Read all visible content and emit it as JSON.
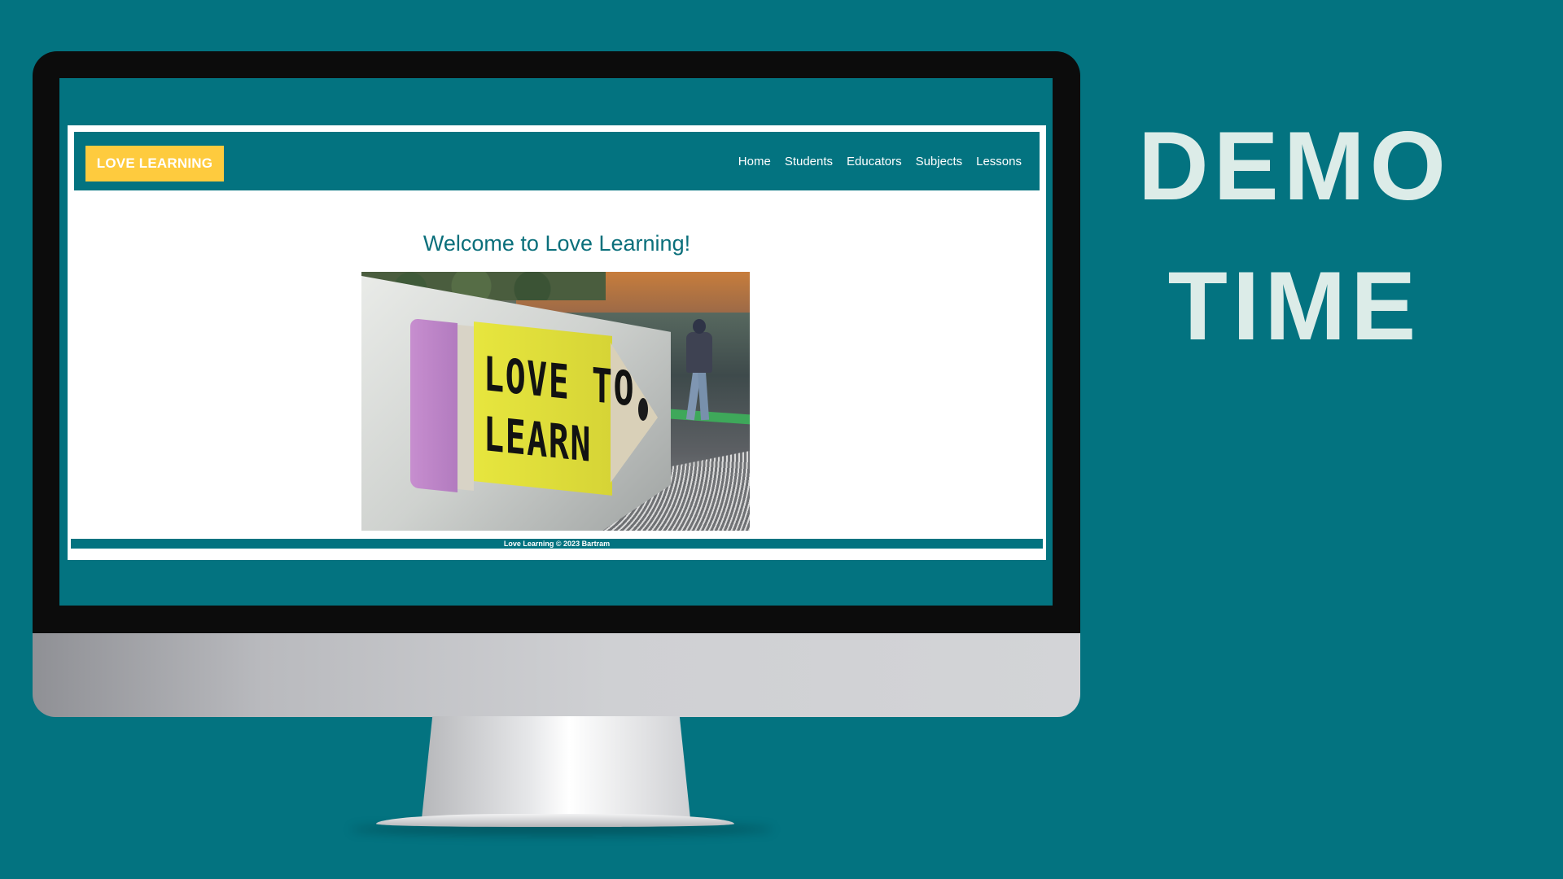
{
  "site": {
    "logo": "LOVE LEARNING",
    "nav": [
      "Home",
      "Students",
      "Educators",
      "Subjects",
      "Lessons"
    ],
    "heading": "Welcome to Love Learning!",
    "hero_sign_text": "LOVE TO\nLEARN",
    "footer": "Love Learning © 2023 Bartram"
  },
  "slide": {
    "title_line1": "DEMO",
    "title_line2": "TIME"
  },
  "colors": {
    "background": "#037380",
    "logo_bg": "#fecb3e",
    "heading": "#0a6f7b",
    "slide_text": "#dcece8"
  }
}
